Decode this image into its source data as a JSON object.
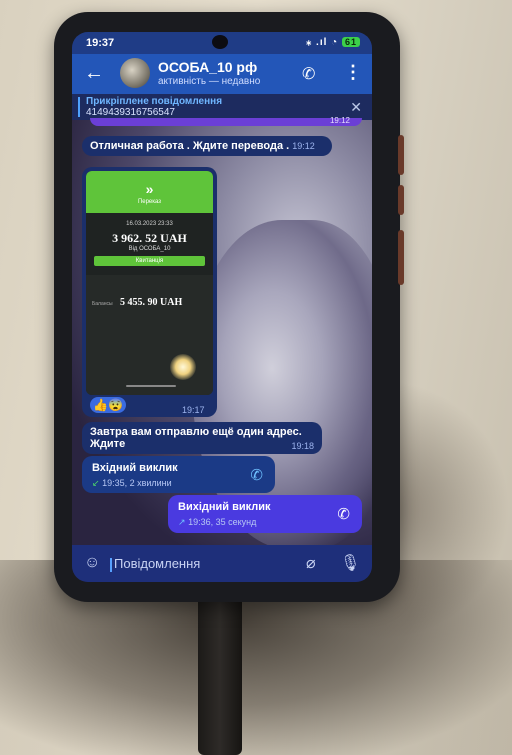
{
  "status_bar": {
    "time": "19:37",
    "icons": "⁎ .ıl ◔",
    "battery": "61"
  },
  "header": {
    "back_icon": "←",
    "chat_name": "ОСОБА_10 рф",
    "chat_status": "активність — недавно",
    "call_icon": "✆",
    "menu_icon": "⋮"
  },
  "pinned": {
    "title": "Прикріплене повідомлення",
    "text": "4149439316756547",
    "close_icon": "✕"
  },
  "messages": {
    "top_time": "19:12",
    "msg1_text": "Отличная работа . Ждите перевода .",
    "msg1_time": "19:12",
    "photo": {
      "header_arrows": "»",
      "header_sub": "Переказ",
      "date": "16.03.2023 23:33",
      "amount": "3 962. 52 UAH",
      "from": "Від ОСОБА_10",
      "button": "Квитанція",
      "panel_label": "Балансы",
      "amount2": "5 455. 90 UAH",
      "reactions": "👍😨",
      "time": "19:17"
    },
    "msg2_text": "Завтра вам отправлю ещё один адрес. Ждите",
    "msg2_time": "19:18"
  },
  "calls": {
    "incoming": {
      "title": "Вхідний виклик",
      "arrow": "↙",
      "meta": "19:35, 2 хвилини"
    },
    "outgoing": {
      "title": "Вихідний виклик",
      "arrow": "↗",
      "meta": "19:36, 35 секунд"
    },
    "phone_icon": "✆"
  },
  "input": {
    "placeholder": "Повідомлення",
    "emoji_icon": "☺",
    "attach_icon": "⌀",
    "mic_icon": "🎙"
  },
  "colors": {
    "header": "#2356b8",
    "bubble_in": "#1b2f6b",
    "bubble_out": "#4a3ae0",
    "accent": "#6fc0ff"
  }
}
